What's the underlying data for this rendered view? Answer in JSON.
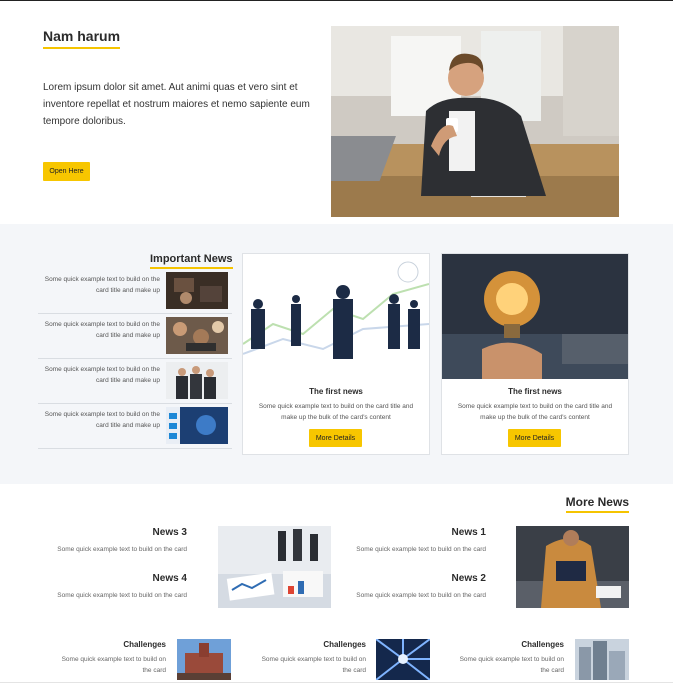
{
  "hero": {
    "title": "Nam harum",
    "text": "Lorem ipsum dolor sit amet. Aut animi quas et vero sint et inventore repellat et nostrum maiores et nemo sapiente eum tempore doloribus.",
    "button": "Open Here"
  },
  "important": {
    "title": "Important News",
    "items": [
      {
        "text": "Some quick example text to build on the card title and make up"
      },
      {
        "text": "Some quick example text to build on the card title and make up"
      },
      {
        "text": "Some quick example text to build on the card title and make up"
      },
      {
        "text": "Some quick example text to build on the card title and make up"
      }
    ]
  },
  "cards": [
    {
      "title": "The first news",
      "text": "Some quick example text to build on the card title and make up the bulk of the card's content",
      "button": "More Details"
    },
    {
      "title": "The first news",
      "text": "Some quick example text to build on the card title and make up the bulk of the card's content",
      "button": "More Details"
    }
  ],
  "more": {
    "title": "More News",
    "news": [
      {
        "title": "News 3",
        "text": "Some quick example text to build on the card"
      },
      {
        "title": "News 4",
        "text": "Some quick example text to build on the card"
      },
      {
        "title": "News 1",
        "text": "Some quick example text to build on the card"
      },
      {
        "title": "News 2",
        "text": "Some quick example text to build on the card"
      }
    ],
    "challenges": [
      {
        "title": "Challenges",
        "text": "Some quick example text to build on the card"
      },
      {
        "title": "Challenges",
        "text": "Some quick example text to build on the card"
      },
      {
        "title": "Challenges",
        "text": "Some quick example text to build on the card"
      }
    ]
  },
  "colors": {
    "accent": "#f7c600",
    "band": "#f4f6f9"
  }
}
